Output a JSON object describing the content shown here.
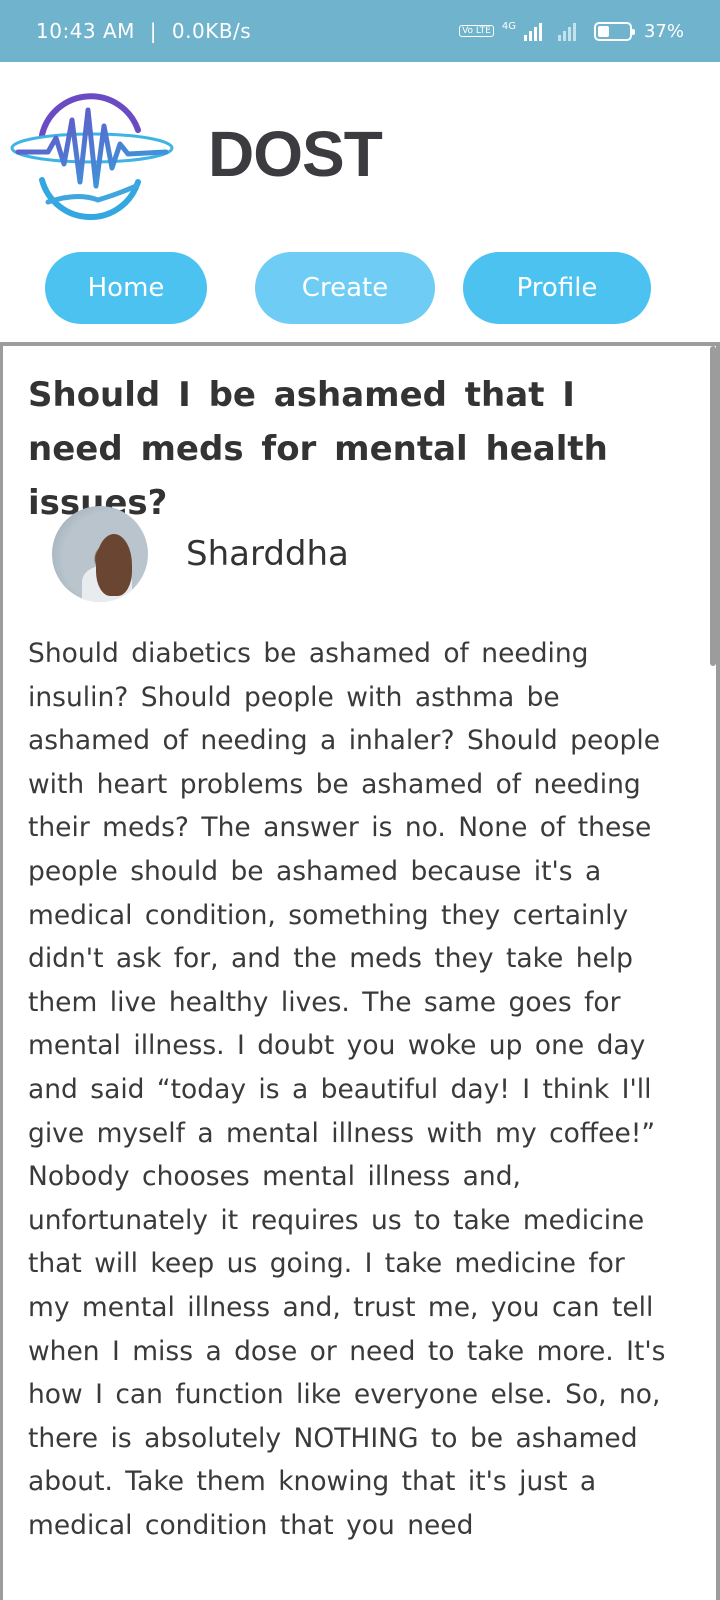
{
  "status_bar": {
    "time": "10:43 AM",
    "separator": "|",
    "speed": "0.0KB/s",
    "network": "4G",
    "volte": "Vo LTE",
    "battery": "37%",
    "battery_level": 0.37
  },
  "app": {
    "brand": "DOST",
    "colors": {
      "accent": "#4cc2f1",
      "status_bar": "#6fb3cc",
      "logo_purple": "#6a4bc4",
      "logo_blue": "#33a8e0"
    }
  },
  "nav": {
    "home": "Home",
    "create": "Create",
    "profile": "Profile"
  },
  "post": {
    "title": "Should I be ashamed that I need meds for mental health issues?",
    "author": "Sharddha",
    "body": "Should diabetics be ashamed of needing insulin? Should people with asthma be ashamed of needing a inhaler? Should people with heart problems be ashamed of needing their meds? The answer is no. None of these people should be ashamed because it's a medical condition, something they certainly didn't ask for, and the meds they take help them live healthy lives. The same goes for mental illness. I doubt you woke up one day and said “today is a beautiful day! I think I'll give myself a mental illness with my coffee!” Nobody chooses mental illness and, unfortunately it requires us to take medicine that will keep us going. I take medicine for my mental illness and, trust me, you can tell when I miss a dose or need to take more. It's how I can function like everyone else. So, no, there is absolutely NOTHING to be ashamed about. Take them knowing that it's just a medical condition that you need"
  }
}
